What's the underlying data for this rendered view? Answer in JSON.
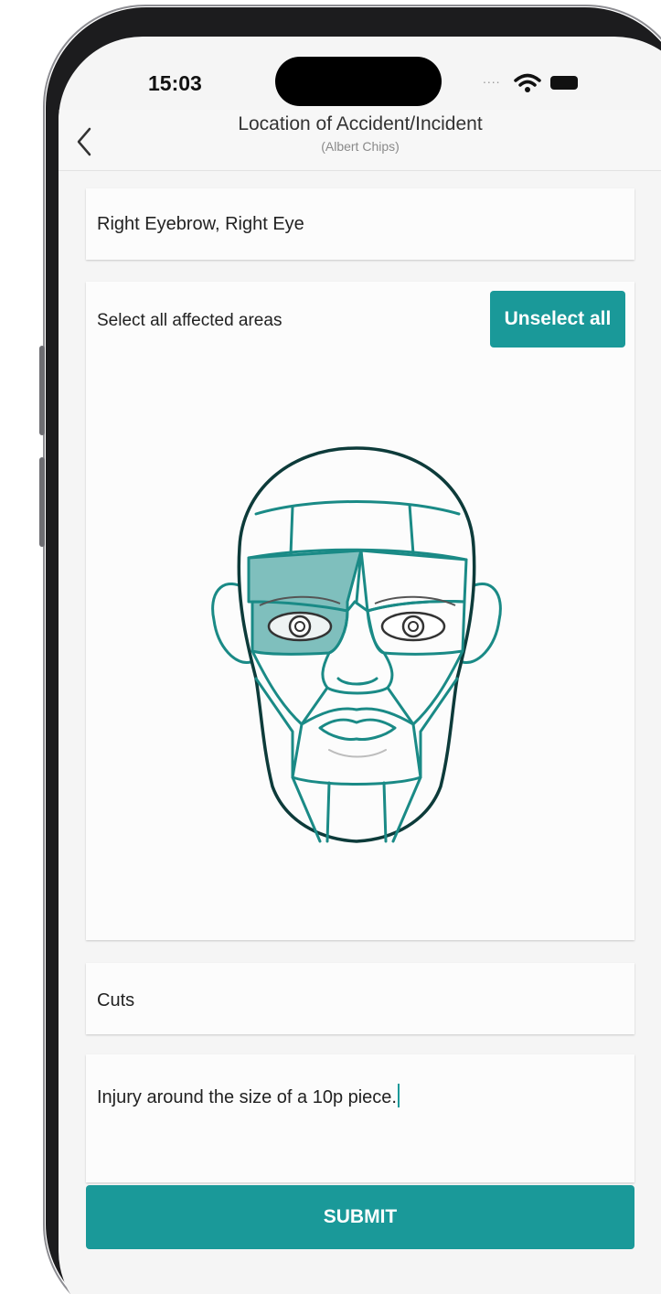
{
  "status_bar": {
    "time": "15:03",
    "signal": "....",
    "icons": [
      "wifi-icon",
      "battery-icon"
    ]
  },
  "header": {
    "title": "Location of Accident/Incident",
    "subtitle": "(Albert Chips)",
    "back_icon": "chevron-left-icon"
  },
  "location": {
    "value": "Right Eyebrow, Right Eye"
  },
  "body_map": {
    "label": "Select all affected areas",
    "unselect_label": "Unselect all",
    "selected_regions": [
      "right-eyebrow",
      "right-eye"
    ]
  },
  "injury_type": {
    "value": "Cuts"
  },
  "notes": {
    "value": "Injury around the size of a 10p piece."
  },
  "submit_label": "SUBMIT",
  "colors": {
    "accent": "#1a9999",
    "selected_fill": "#7fbfbd",
    "outline": "#1a8a86"
  }
}
